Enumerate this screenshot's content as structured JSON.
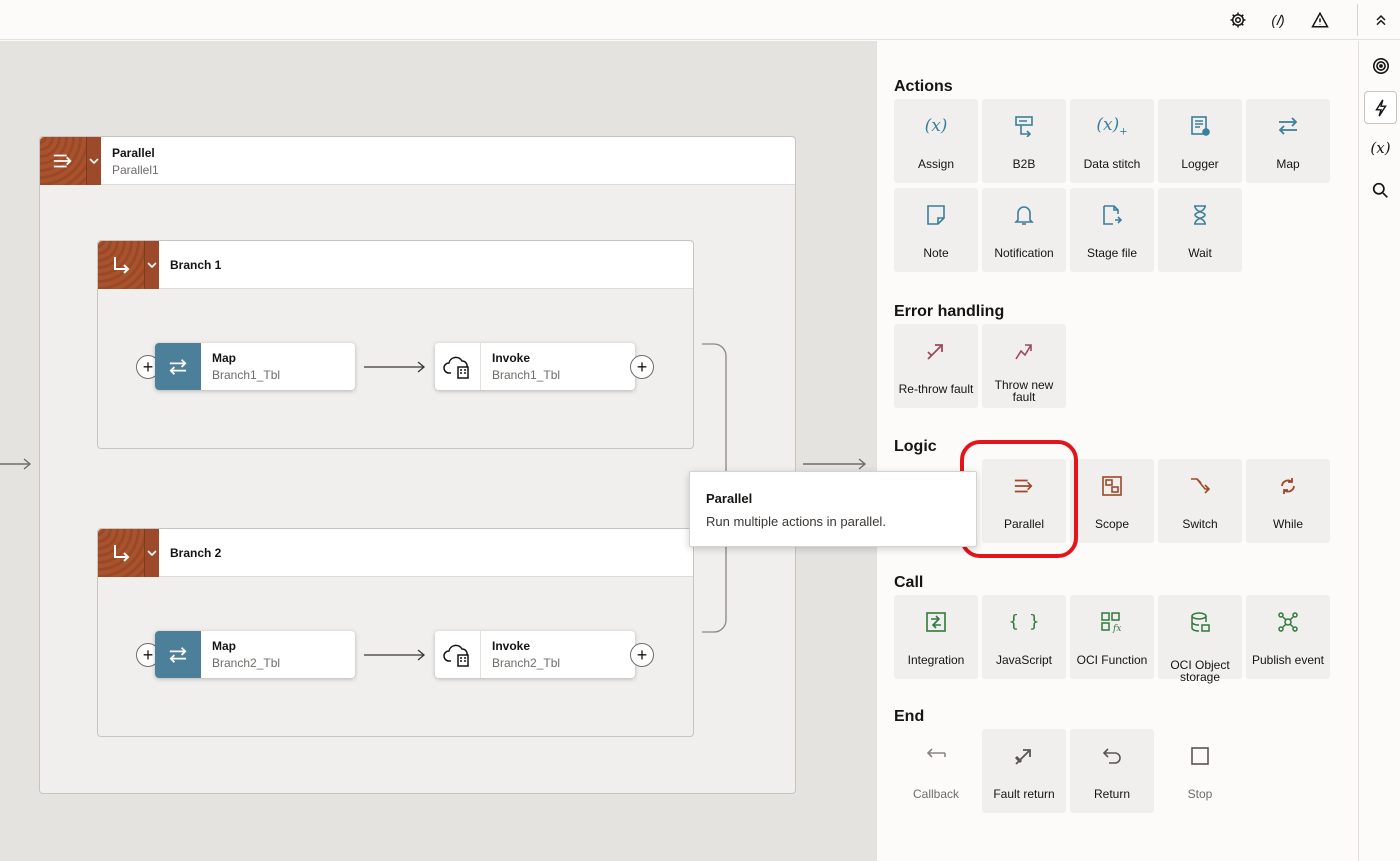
{
  "topbar": {
    "icons": [
      "gear-icon",
      "variables-icon",
      "warning-icon",
      "collapse-up-icon"
    ],
    "variables_glyph": "(𝐼)"
  },
  "canvas": {
    "parallel": {
      "title": "Parallel",
      "subtitle": "Parallel1"
    },
    "branches": [
      {
        "title": "Branch 1",
        "map": {
          "title": "Map",
          "subtitle": "Branch1_Tbl"
        },
        "invoke": {
          "title": "Invoke",
          "subtitle": "Branch1_Tbl"
        }
      },
      {
        "title": "Branch 2",
        "map": {
          "title": "Map",
          "subtitle": "Branch2_Tbl"
        },
        "invoke": {
          "title": "Invoke",
          "subtitle": "Branch2_Tbl"
        }
      }
    ]
  },
  "tooltip": {
    "title": "Parallel",
    "description": "Run multiple actions in parallel."
  },
  "palette": {
    "sections": {
      "actions": "Actions",
      "error_handling": "Error handling",
      "logic": "Logic",
      "call": "Call",
      "end": "End"
    },
    "actions": [
      "Assign",
      "B2B",
      "Data stitch",
      "Logger",
      "Map",
      "Note",
      "Notification",
      "Stage file",
      "Wait"
    ],
    "error_handling": [
      "Re-throw fault",
      "Throw new fault"
    ],
    "logic": [
      "Parallel",
      "Scope",
      "Switch",
      "While"
    ],
    "call": [
      "Integration",
      "JavaScript",
      "OCI Function",
      "OCI Object storage",
      "Publish event"
    ],
    "end": [
      "Callback",
      "Fault return",
      "Return",
      "Stop"
    ]
  },
  "rail": {
    "icons": [
      "target-icon",
      "lightning-icon",
      "variables-icon",
      "search-icon"
    ],
    "variables_glyph": "(x)"
  },
  "colors": {
    "action_icon": "#3a7f9b",
    "error_icon": "#a0485c",
    "logic_icon": "#9c4a29",
    "call_icon": "#2f7a3d",
    "end_icon": "#5a5652",
    "highlight": "#e3151a",
    "node_map": "#4c7f9a",
    "parallel_brand": "#a9532e"
  }
}
